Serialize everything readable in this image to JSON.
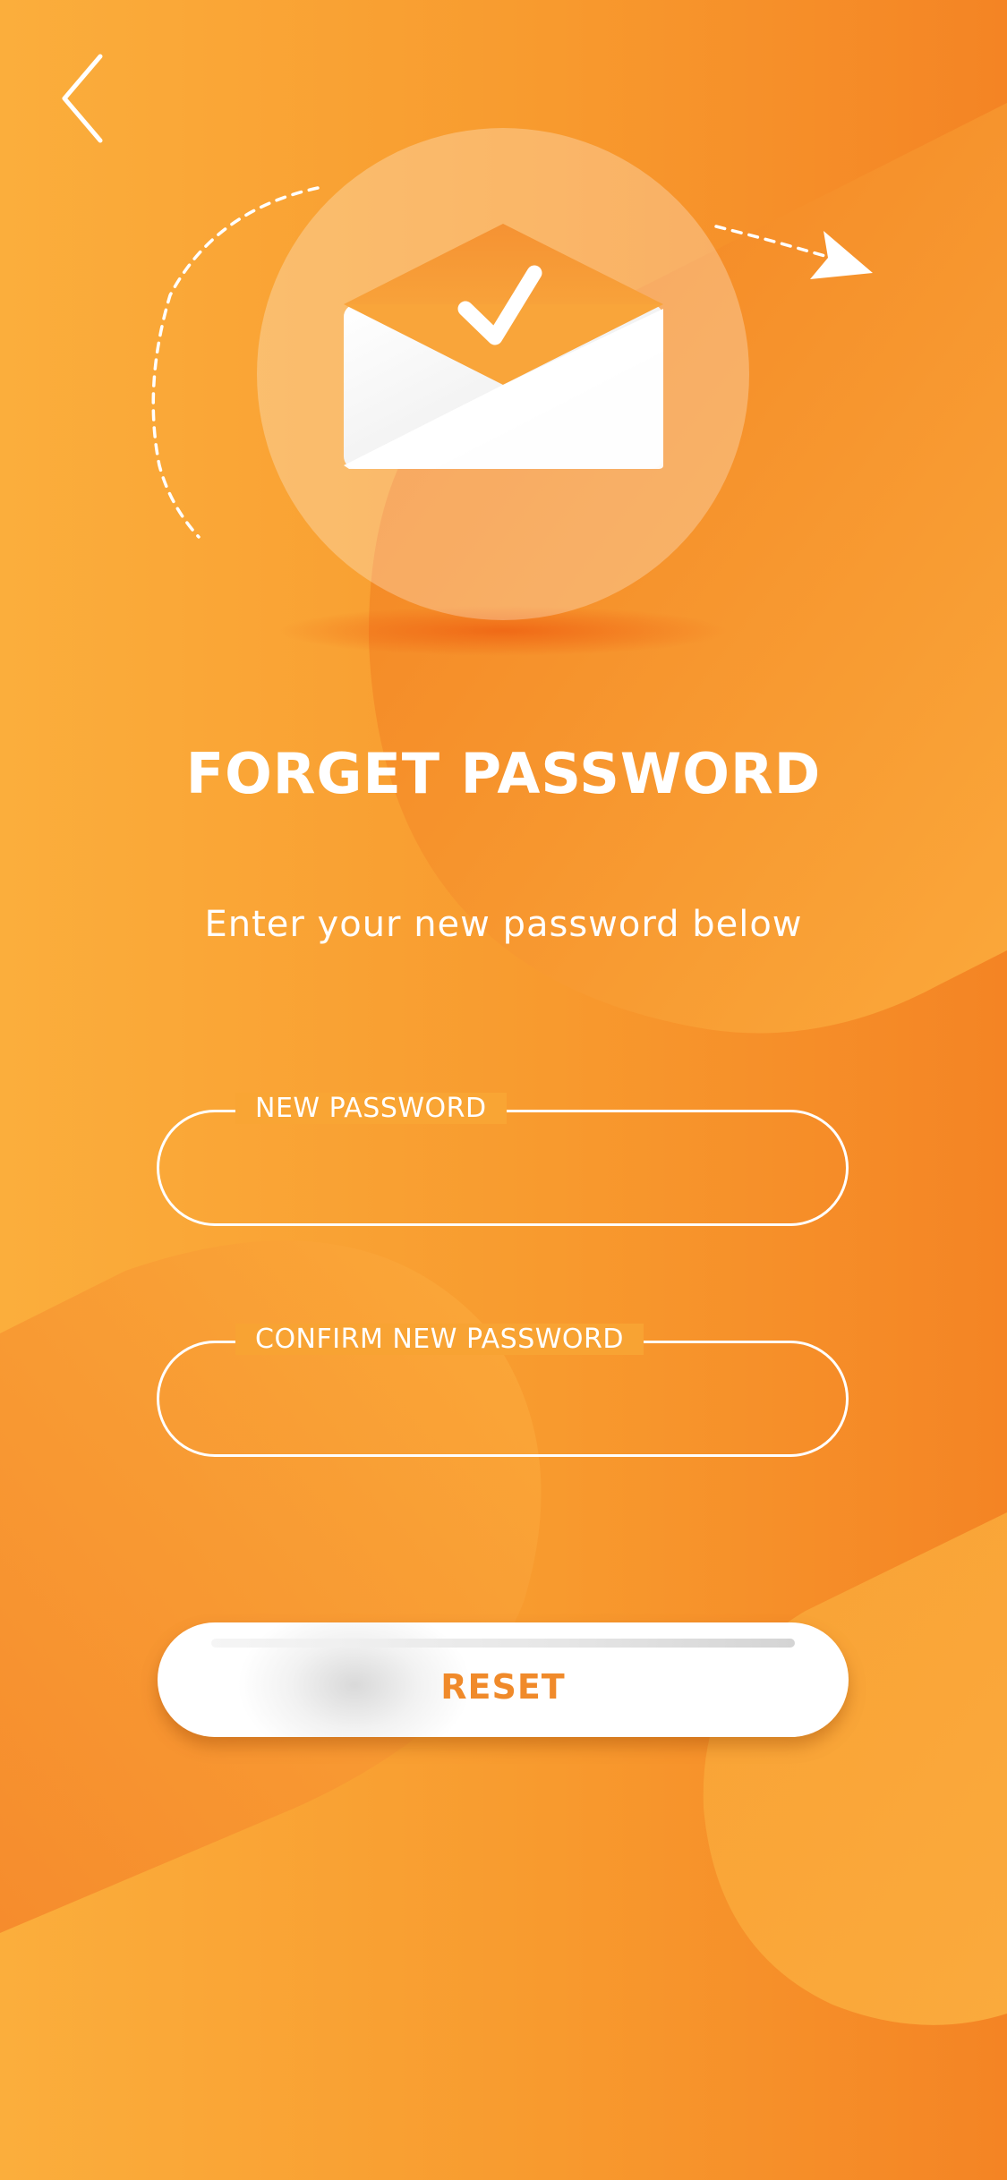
{
  "screen": {
    "title": "FORGET PASSWORD",
    "subtitle": "Enter your new password below"
  },
  "icons": {
    "back": "chevron-left-icon",
    "hero": "envelope-check-icon"
  },
  "form": {
    "new_password_label": "NEW PASSWORD",
    "new_password_value": "",
    "confirm_password_label": "CONFIRM NEW PASSWORD",
    "confirm_password_value": "",
    "reset_label": "RESET"
  },
  "colors": {
    "background_light": "#fbae3c",
    "background_dark": "#f48424",
    "accent_text": "#f08a2a",
    "foreground": "#ffffff"
  }
}
